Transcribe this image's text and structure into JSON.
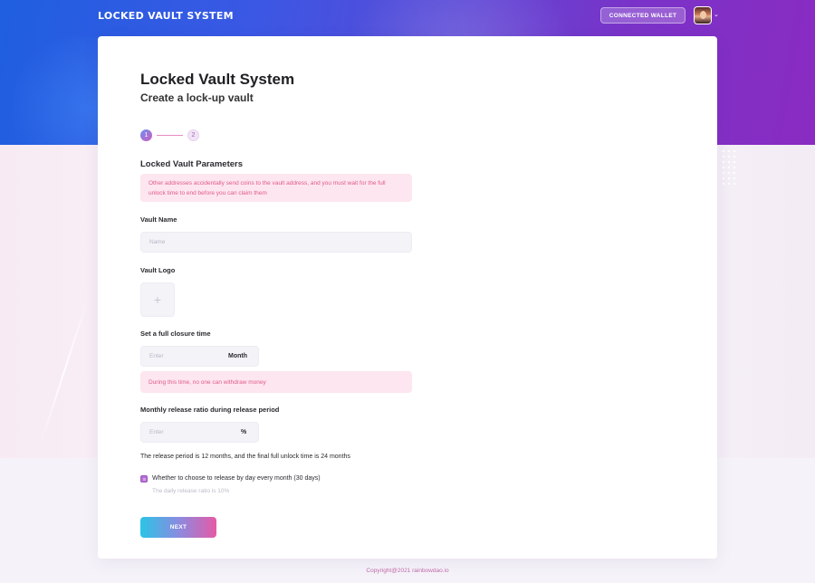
{
  "header": {
    "brand": "LOCKED VAULT SYSTEM",
    "wallet_button": "CONNECTED WALLET",
    "avatar_caret": "⌄"
  },
  "page": {
    "title": "Locked Vault System",
    "subtitle": "Create a lock-up vault"
  },
  "steps": [
    {
      "label": "1",
      "active": true
    },
    {
      "label": "2",
      "active": false
    }
  ],
  "form": {
    "section_title": "Locked Vault Parameters",
    "notice_warning": "Other addresses accidentally send coins to the vault address, and you must wait for the full unlock time to end before you can claim them",
    "vault_name_label": "Vault Name",
    "vault_name_placeholder": "Name",
    "vault_logo_label": "Vault Logo",
    "upload_plus": "+",
    "closure_label": "Set a full closure time",
    "closure_placeholder": "Enter",
    "closure_unit": "Month",
    "closure_notice": "During this time, no one can withdraw money",
    "release_label": "Monthly release ratio during release period",
    "release_placeholder": "Enter",
    "release_unit": "%",
    "release_info": "The release period is 12 months, and the final full unlock time is 24 months",
    "daily_checkbox_label": "Whether to choose to release by day every month (30 days)",
    "daily_checkbox_checked": true,
    "daily_hint": "The daily release ratio is 10%",
    "next_button": "NEXT"
  },
  "footer": {
    "copyright": "Copyright@2021 rainbowdao.io"
  },
  "colors": {
    "header_start": "#1f5fe0",
    "header_end": "#8a2bc2",
    "notice_bg": "#fde6ef",
    "notice_text": "#e05a8a",
    "button_start": "#2bc4e6",
    "button_end": "#e55aa6",
    "checkbox": "#b56fd2"
  }
}
